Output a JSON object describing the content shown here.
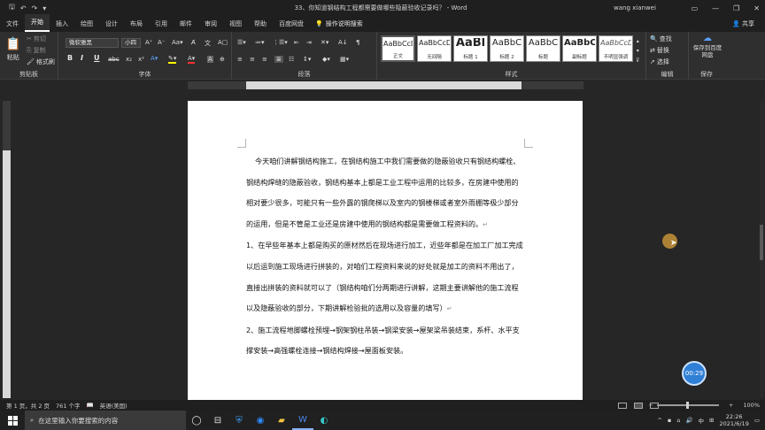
{
  "window": {
    "title": "33、你知道钢结构工程都需要做哪些隐蔽验收记录吗？ - Word",
    "user": "wang xianwei"
  },
  "tabs": [
    "文件",
    "开始",
    "插入",
    "绘图",
    "设计",
    "布局",
    "引用",
    "邮件",
    "审阅",
    "视图",
    "帮助",
    "百度网盘"
  ],
  "active_tab": "开始",
  "tellme": "操作说明搜索",
  "share": "共享",
  "ribbon": {
    "clipboard": {
      "paste": "粘贴",
      "cut": "剪切",
      "copy": "复制",
      "painter": "格式刷",
      "label": "剪贴板"
    },
    "font": {
      "name": "微软雅黑",
      "size": "小四",
      "label": "字体",
      "bold": "B",
      "italic": "I",
      "underline": "U"
    },
    "paragraph": {
      "label": "段落"
    },
    "styles": {
      "label": "样式",
      "items": [
        {
          "sample": "AaBbCcDi",
          "name": "正文"
        },
        {
          "sample": "AaBbCcDi",
          "name": "无间隔"
        },
        {
          "sample": "AaBl",
          "name": "标题 1"
        },
        {
          "sample": "AaBbC",
          "name": "标题 2"
        },
        {
          "sample": "AaBbC",
          "name": "标题"
        },
        {
          "sample": "AaBbC",
          "name": "副标题"
        },
        {
          "sample": "AaBbCcDi",
          "name": "不明显强调"
        }
      ]
    },
    "editing": {
      "find": "查找",
      "replace": "替换",
      "select": "选择",
      "label": "编辑"
    },
    "save": {
      "btn": "保存到百度网盘",
      "label": "保存"
    }
  },
  "document": {
    "paragraphs": [
      "今天咱们讲解钢结构施工，在钢结构施工中我们需要做的隐蔽验收只有钢结构螺栓、钢结构焊缝的隐蔽验收，钢结构基本上都是工业工程中运用的比较多，在房建中使用的相对要少很多，可能只有一些外露的钢爬梯以及室内的钢楼梯或者室外雨棚等极少部分的运用，但是不管是工业还是房建中使用的钢结构都是需要做工程资料的。",
      "1、在早些年基本上都是购买的原材然后在现场进行加工，近些年都是在加工厂加工完成以后运到施工现场进行拼装的，对咱们工程资料来说的好处就是加工的资料不用出了，直接出拼装的资料就可以了（钢结构咱们分两期进行讲解，这期主要讲解他的施工流程以及隐蔽验收的部分，下期讲解检验批的选用以及容量的填写）",
      "2、施工流程地脚螺栓预埋→钢架钢柱吊装→钢梁安装→屋架梁吊装结束，系杆、水平支撑安装→高强螺栓连接→钢结构焊接→屋面板安装。"
    ]
  },
  "timer": "00:29",
  "status": {
    "page": "第 1 页，共 2 页",
    "words": "761 个字",
    "lang": "英语(美国)",
    "zoom": "100%"
  },
  "taskbar": {
    "search_placeholder": "在这里输入你要搜索的内容",
    "time": "22:26",
    "date": "2021/6/19",
    "ime": "中"
  }
}
